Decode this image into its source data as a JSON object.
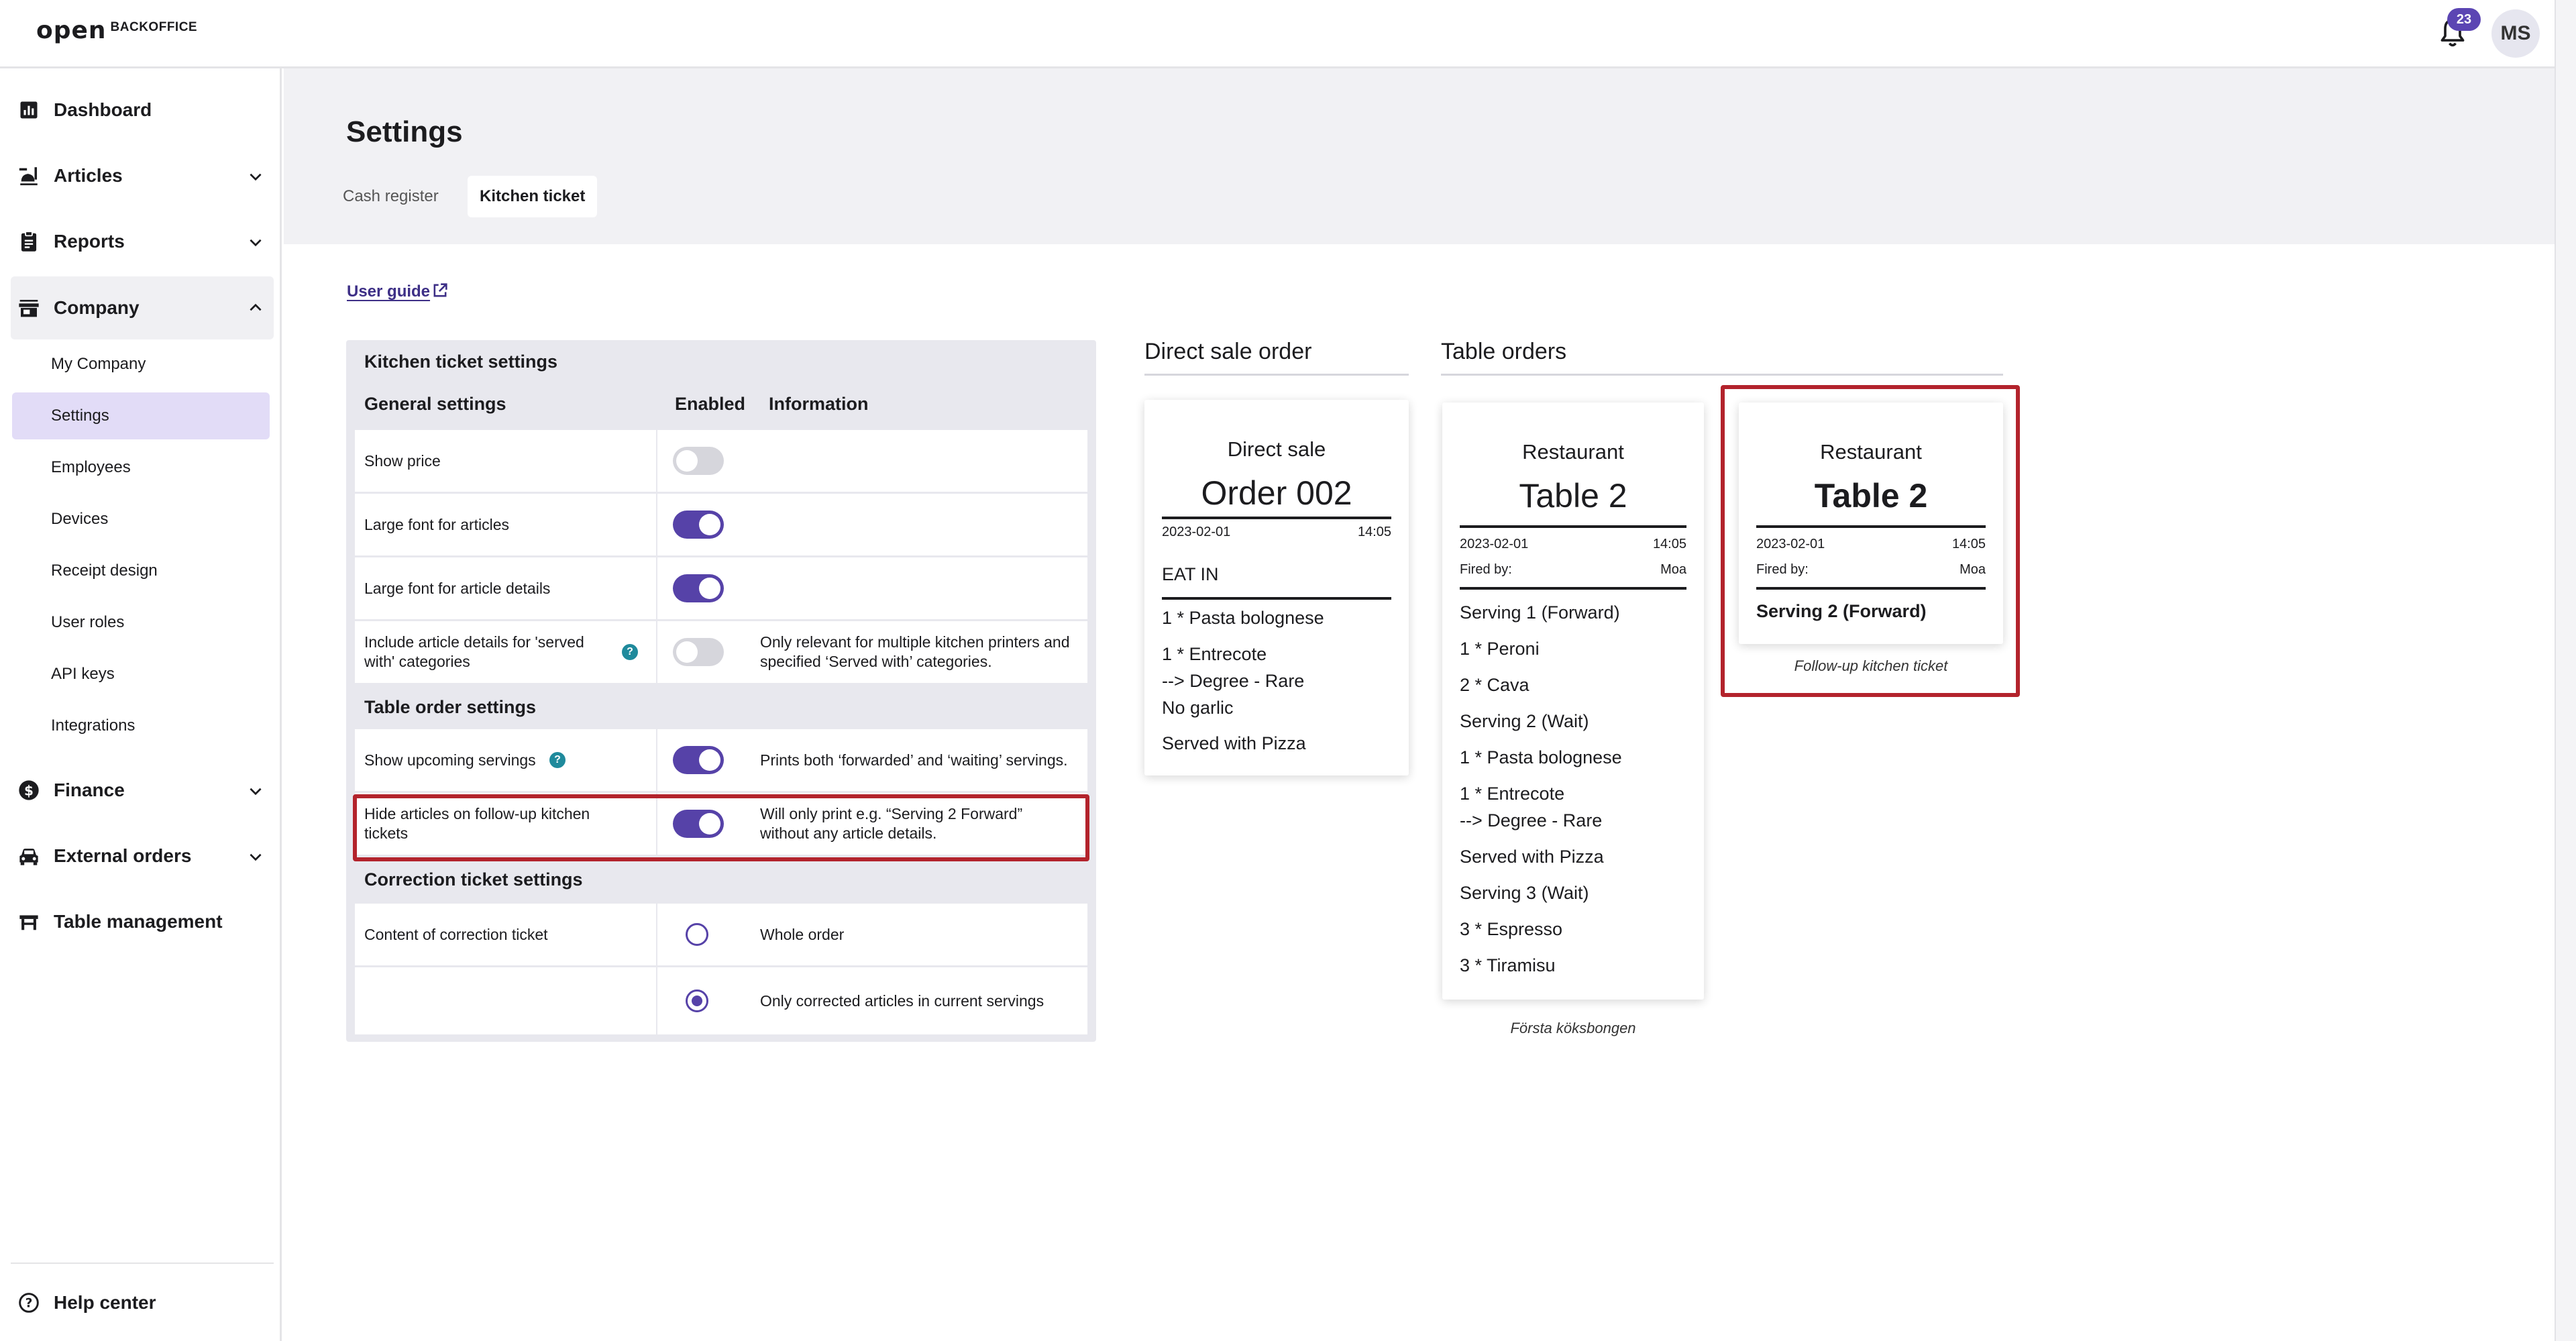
{
  "header": {
    "logo_text": "open",
    "logo_suffix": "BACKOFFICE",
    "notification_count": "23",
    "avatar_initials": "MS"
  },
  "sidebar": {
    "items": [
      {
        "label": "Dashboard",
        "icon": "chart-icon"
      },
      {
        "label": "Articles",
        "icon": "food-icon"
      },
      {
        "label": "Reports",
        "icon": "clipboard-icon"
      },
      {
        "label": "Company",
        "icon": "store-icon"
      },
      {
        "label": "Finance",
        "icon": "dollar-icon"
      },
      {
        "label": "External orders",
        "icon": "car-icon"
      },
      {
        "label": "Table management",
        "icon": "table-icon"
      }
    ],
    "company_sub": [
      "My Company",
      "Settings",
      "Employees",
      "Devices",
      "Receipt design",
      "User roles",
      "API keys",
      "Integrations"
    ],
    "help": "Help center"
  },
  "page": {
    "title": "Settings",
    "tabs": [
      "Cash register",
      "Kitchen ticket"
    ],
    "active_tab": "Kitchen ticket",
    "user_guide": "User guide"
  },
  "settings": {
    "panel_title": "Kitchen ticket settings",
    "general": "General settings",
    "col_enabled": "Enabled",
    "col_information": "Information",
    "rows": [
      {
        "label": "Show price",
        "enabled": false,
        "info": ""
      },
      {
        "label": "Large font for articles",
        "enabled": true,
        "info": ""
      },
      {
        "label": "Large font for article details",
        "enabled": true,
        "info": ""
      },
      {
        "label": "Include article details for 'served with' categories",
        "enabled": false,
        "info": "Only relevant for multiple kitchen printers and specified ‘Served with’ categories."
      }
    ],
    "table_order": "Table order settings",
    "table_rows": [
      {
        "label": "Show upcoming servings",
        "enabled": true,
        "info": "Prints both ‘forwarded’ and ‘waiting’ servings."
      },
      {
        "label": "Hide articles on follow-up kitchen tickets",
        "enabled": true,
        "info": "Will only print e.g. “Serving 2 Forward” without any article details."
      }
    ],
    "correction": "Correction ticket settings",
    "correction_label": "Content of correction ticket",
    "correction_options": [
      "Whole order",
      "Only corrected articles in current servings"
    ],
    "correction_selected": 1
  },
  "previews": {
    "direct_title": "Direct sale order",
    "table_title": "Table orders",
    "direct_ticket": {
      "head": "Direct sale",
      "big": "Order 002",
      "date": "2023-02-01",
      "time": "14:05",
      "type": "EAT IN",
      "lines": [
        "1 * Pasta bolognese",
        "1 * Entrecote",
        "--> Degree - Rare",
        "No garlic",
        "Served with Pizza"
      ]
    },
    "table_ticket": {
      "head": "Restaurant",
      "big": "Table 2",
      "date": "2023-02-01",
      "time": "14:05",
      "fired_label": "Fired by:",
      "fired_by": "Moa",
      "lines": [
        "Serving 1 (Forward)",
        "1 * Peroni",
        "2 * Cava",
        "Serving 2 (Wait)",
        "1 * Pasta bolognese",
        "1 * Entrecote",
        "--> Degree - Rare",
        "Served with Pizza",
        "Serving 3 (Wait)",
        "3 * Espresso",
        "3 * Tiramisu"
      ],
      "caption": "Första köksbongen"
    },
    "followup_ticket": {
      "head": "Restaurant",
      "big": "Table 2",
      "date": "2023-02-01",
      "time": "14:05",
      "fired_label": "Fired by:",
      "fired_by": "Moa",
      "line": "Serving 2 (Forward)",
      "caption": "Follow-up kitchen ticket"
    }
  },
  "colors": {
    "accent": "#5642a8",
    "highlight": "#b3232c",
    "selected_bg": "#e2dcf7"
  }
}
